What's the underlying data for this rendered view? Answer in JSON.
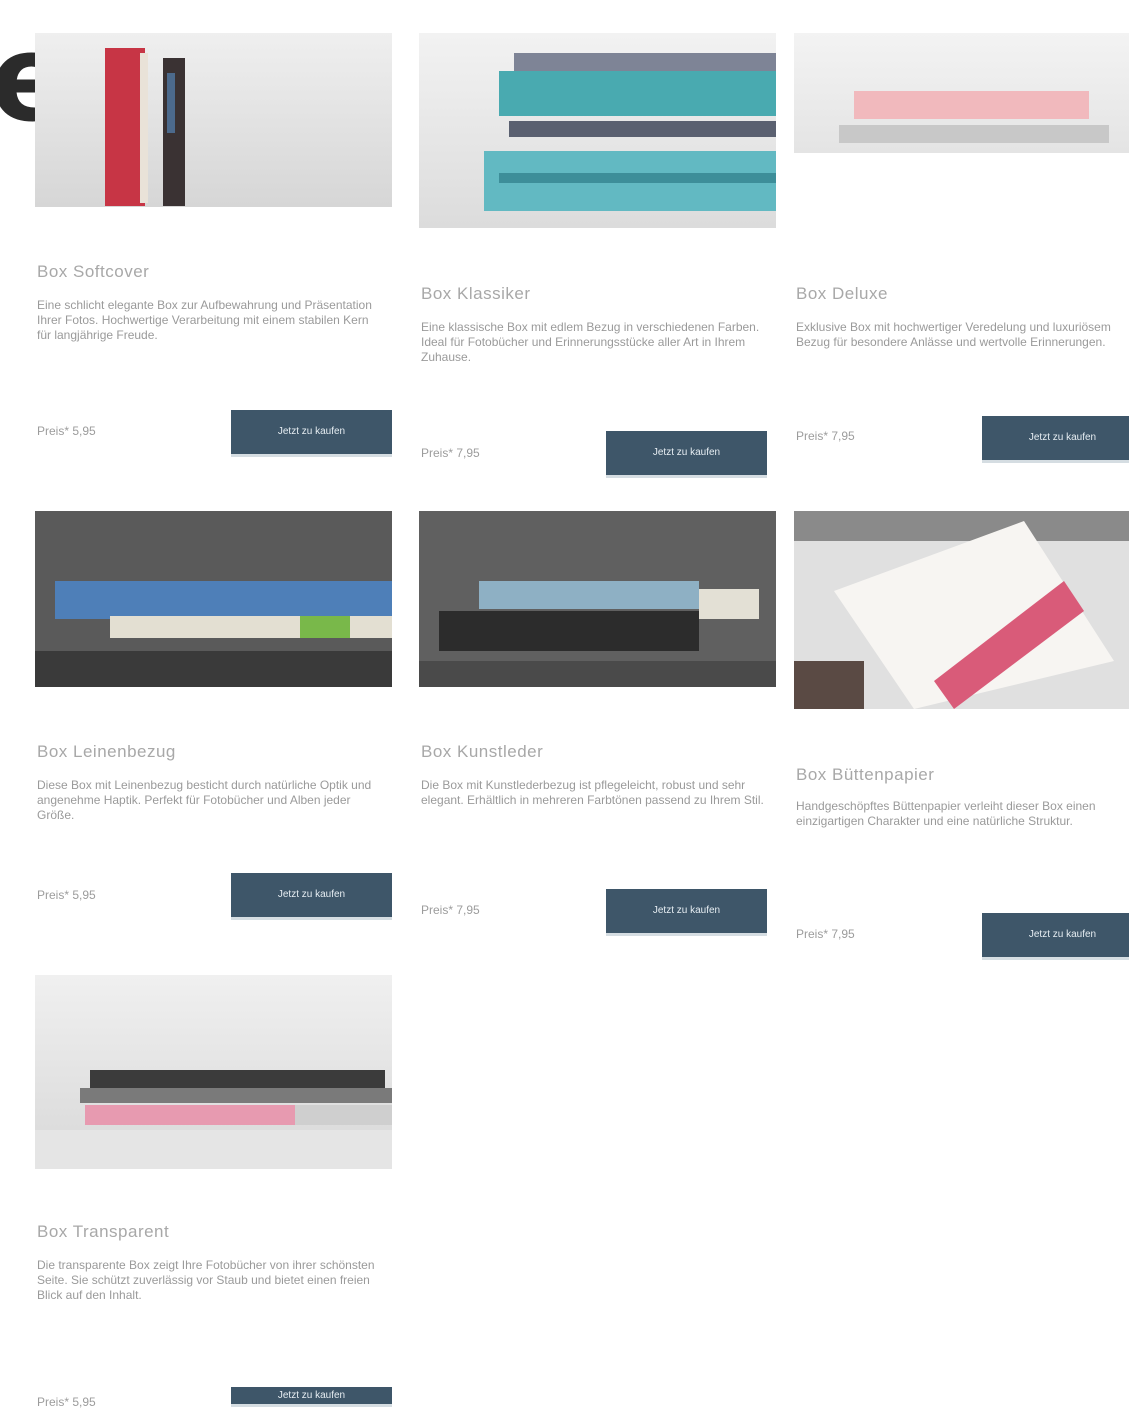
{
  "header": {
    "letter": "e"
  },
  "cards": [
    {
      "title": "Box Softcover",
      "description": "Eine schlicht elegante Box zur Aufbewahrung und Präsentation Ihrer Fotos. Hochwertige Verarbeitung mit einem stabilen Kern für langjährige Freude.",
      "price": "Preis* 5,95",
      "button": "Jetzt zu kaufen",
      "image": "photo-red-brown-box"
    },
    {
      "title": "Box Klassiker",
      "description": "Eine klassische Box mit edlem Bezug in verschiedenen Farben. Ideal für Fotobücher und Erinnerungsstücke aller Art in Ihrem Zuhause.",
      "price": "Preis* 7,95",
      "button": "Jetzt zu kaufen",
      "image": "photo-teal-books-stack"
    },
    {
      "title": "Box Deluxe",
      "description": "Exklusive Box mit hochwertiger Veredelung und luxuriösem Bezug für besondere Anlässe und wertvolle Erinnerungen.",
      "price": "Preis* 7,95",
      "button": "Jetzt zu kaufen",
      "image": "photo-pink-box-lid"
    },
    {
      "title": "Box Leinenbezug",
      "description": "Diese Box mit Leinenbezug besticht durch natürliche Optik und angenehme Haptik. Perfekt für Fotobücher und Alben jeder Größe.",
      "price": "Preis* 5,95",
      "button": "Jetzt zu kaufen",
      "image": "photo-blue-green-books-dark"
    },
    {
      "title": "Box Kunstleder",
      "description": "Die Box mit Kunstlederbezug ist pflegeleicht, robust und sehr elegant. Erhältlich in mehreren Farbtönen passend zu Ihrem Stil.",
      "price": "Preis* 7,95",
      "button": "Jetzt zu kaufen",
      "image": "photo-dark-books-grey"
    },
    {
      "title": "Box Büttenpapier",
      "description": "Handgeschöpftes Büttenpapier verleiht dieser Box einen einzigartigen Charakter und eine natürliche Struktur.",
      "price": "Preis* 7,95",
      "button": "Jetzt zu kaufen",
      "image": "photo-red-white-card"
    },
    {
      "title": "Box Transparent",
      "description": "Die transparente Box zeigt Ihre Fotobücher von ihrer schönsten Seite. Sie schützt zuverlässig vor Staub und bietet einen freien Blick auf den Inhalt.",
      "price": "Preis* 5,95",
      "button": "Jetzt zu kaufen",
      "image": "photo-stacked-books-light"
    }
  ],
  "colors": {
    "button_bg": "#3e5669",
    "accent": "#d95b79"
  }
}
